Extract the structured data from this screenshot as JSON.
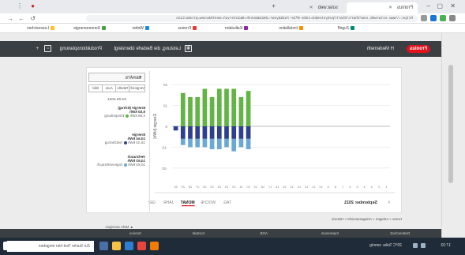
{
  "browser": {
    "tabs": [
      {
        "label": "Fronius",
        "active": true
      },
      {
        "label": "solar.web",
        "active": false
      }
    ],
    "url": "https://www.solarweb.com/Chart/Chart?pvSystemId=c3d4-9f2e-7a1b&year=2021&month=9&interval=month&view=production",
    "bookmarks": [
      "Lesezeichen",
      "Sonnenenergie",
      "Wetter",
      "Fronius",
      "Kalkulator",
      "Installation",
      "Zugriff"
    ]
  },
  "app": {
    "logo": "Fronius",
    "user": "H Medemeth",
    "header_links": [
      "Leistung, die Bedarfe übersteigt",
      "Produktionsplanung"
    ]
  },
  "chart_panel": {
    "period_tabs": [
      "TAG",
      "WOCHE",
      "MONAT",
      "JAHR",
      "GESAMT"
    ],
    "active_tab": "MONAT",
    "period_label": "September 2021",
    "y_axis_label": "Energie [kWh]",
    "x_ticks": [
      "1",
      "2",
      "3",
      "4",
      "5",
      "6",
      "7",
      "8",
      "9",
      "10",
      "11",
      "12",
      "13",
      "14",
      "15",
      "16",
      "17",
      "18",
      "19",
      "20",
      "21",
      "22",
      "23",
      "24",
      "25",
      "26",
      "27",
      "28",
      "29",
      "30"
    ]
  },
  "chart_data": {
    "type": "bar",
    "categories": [
      "1",
      "2",
      "3",
      "4",
      "5",
      "6",
      "7",
      "8",
      "9",
      "10",
      "11",
      "12",
      "13",
      "14",
      "15",
      "16",
      "17",
      "18",
      "19",
      "20",
      "21",
      "22",
      "23",
      "24",
      "25",
      "26",
      "27",
      "28",
      "29",
      "30"
    ],
    "series": [
      {
        "name": "Eigenverbrauch",
        "color": "#62b444",
        "values": [
          0,
          0,
          0,
          0,
          0,
          0,
          0,
          0,
          0,
          0,
          0,
          0,
          0,
          0,
          0,
          0,
          0,
          0,
          0,
          17,
          14,
          18,
          18,
          18,
          14,
          18,
          14,
          14,
          16,
          0
        ]
      },
      {
        "name": "Netzbezug",
        "color": "#2f3f8f",
        "values": [
          0,
          0,
          0,
          0,
          0,
          0,
          0,
          0,
          0,
          0,
          0,
          0,
          0,
          0,
          0,
          0,
          0,
          0,
          0,
          -6,
          -6,
          -6,
          -6,
          -6,
          -6,
          -6,
          -6,
          -6,
          -6,
          -2
        ]
      },
      {
        "name": "Direktverbrauch",
        "color": "#6aa9d1",
        "values": [
          0,
          0,
          0,
          0,
          0,
          0,
          0,
          0,
          0,
          0,
          0,
          0,
          0,
          0,
          0,
          0,
          0,
          0,
          0,
          -5,
          -4,
          -6,
          -4,
          -5,
          -5,
          -4,
          -4,
          -4,
          -3,
          0
        ]
      }
    ],
    "ylim": [
      -25,
      25
    ]
  },
  "sidebar": {
    "select_label": "GERÄTE",
    "buttons": [
      "Vergleich",
      "Tabelle",
      "Auto",
      "Bild"
    ],
    "date": "04.09.2021",
    "produktion": {
      "title": "Energie (Ertrag)",
      "value": "5,53 kWh",
      "detail_value": "4,68 kWh",
      "detail_label": "Einspeisung"
    },
    "verbrauch": {
      "title": "Energie",
      "value": "24,54 kWh",
      "detail_value": "15,43 kWh",
      "detail_label": "Netzbezug"
    },
    "eigen": {
      "title": "Verbrauch",
      "value": "14,63 kWh",
      "detail_value": "10,83 kWh",
      "detail_label": "Eigenverbrauch"
    }
  },
  "footer": {
    "breadcrumb": "Home » Anlagen » Anlagenansicht » Historie",
    "items": [
      "Datenschutz",
      "Impressum",
      "AGB",
      "Kontakt",
      "Service"
    ],
    "more": "Mehr anzeigen"
  },
  "taskbar": {
    "search_placeholder": "Zur Suche Text hier eingeben",
    "time": "17:33",
    "weather": "20°C Teilw. sonnig"
  }
}
